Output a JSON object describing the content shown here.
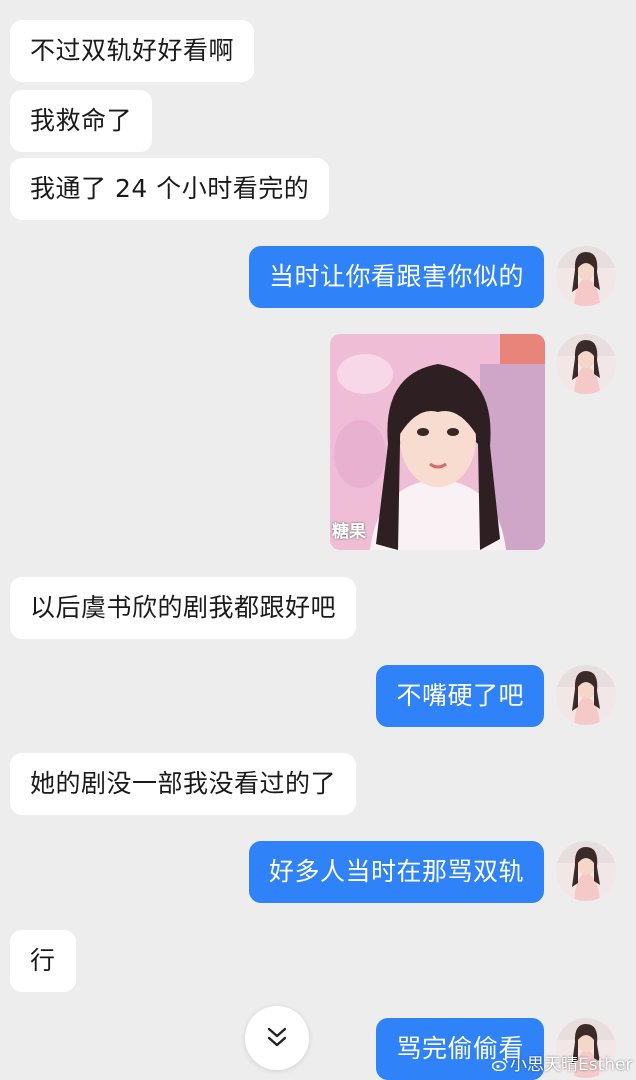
{
  "messages": [
    {
      "side": "in",
      "text": "不过双轨好好看啊"
    },
    {
      "side": "in",
      "text": "我救命了"
    },
    {
      "side": "in",
      "text": "我通了 24 个小时看完的"
    },
    {
      "side": "out",
      "text": "当时让你看跟害你似的"
    },
    {
      "side": "out",
      "image": "sticker-photo",
      "image_caption": "糖果"
    },
    {
      "side": "in",
      "text": "以后虞书欣的剧我都跟好吧"
    },
    {
      "side": "out",
      "text": "不嘴硬了吧"
    },
    {
      "side": "in",
      "text": "她的剧没一部我没看过的了"
    },
    {
      "side": "out",
      "text": "好多人当时在那骂双轨"
    },
    {
      "side": "in",
      "text": "行"
    },
    {
      "side": "out",
      "text": "骂完偷偷看"
    }
  ],
  "scroll_button": {
    "icon": "double-chevron-down-icon"
  },
  "watermark": {
    "text": "小思天晴Esther",
    "icon": "weibo-icon"
  },
  "colors": {
    "background": "#ededed",
    "incoming_bubble": "#ffffff",
    "outgoing_bubble": "#2f82f7",
    "outgoing_text": "#ffffff"
  }
}
